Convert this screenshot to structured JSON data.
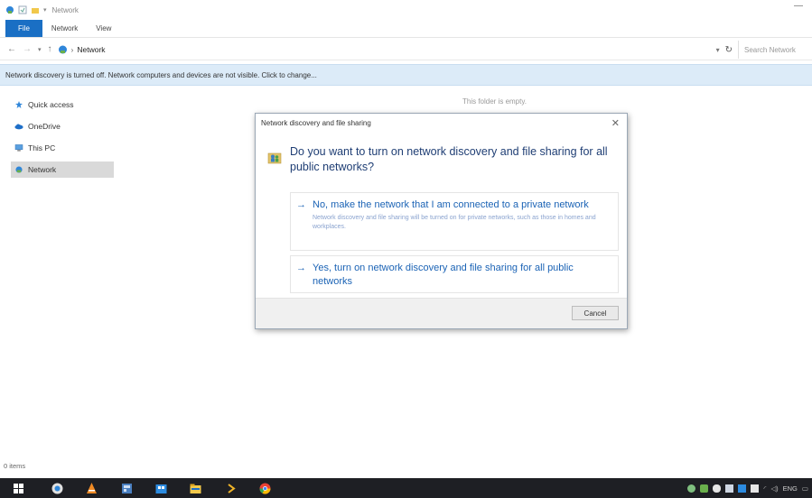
{
  "window": {
    "title": "Network"
  },
  "ribbon": {
    "tabs": [
      "File",
      "Network",
      "View"
    ]
  },
  "address": {
    "location": "Network",
    "search_placeholder": "Search Network"
  },
  "infobar": {
    "message": "Network discovery is turned off. Network computers and devices are not visible. Click to change..."
  },
  "nav_pane": {
    "items": [
      {
        "label": "Quick access",
        "icon": "star-icon"
      },
      {
        "label": "OneDrive",
        "icon": "cloud-icon"
      },
      {
        "label": "This PC",
        "icon": "computer-icon"
      },
      {
        "label": "Network",
        "icon": "network-icon"
      }
    ]
  },
  "content": {
    "empty_text": "This folder is empty."
  },
  "status": {
    "items_count": "0 items"
  },
  "dialog": {
    "title": "Network discovery and file sharing",
    "question": "Do you want to turn on network discovery and file sharing for all public networks?",
    "option_private": {
      "main": "No, make the network that I am connected to a private network",
      "sub": "Network discovery and file sharing will be turned on for private networks, such as those in homes and workplaces."
    },
    "option_public": {
      "main": "Yes, turn on network discovery and file sharing for all public networks"
    },
    "cancel_label": "Cancel"
  },
  "taskbar": {
    "language": "ENG"
  },
  "colors": {
    "accent": "#1a6fc4",
    "infobar": "#dcebf8",
    "taskbar": "#1e1f24",
    "link": "#1b63b5"
  }
}
